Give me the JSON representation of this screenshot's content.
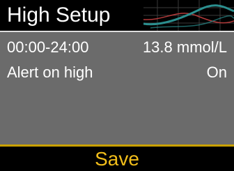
{
  "header": {
    "title": "High Setup"
  },
  "settings": {
    "rows": [
      {
        "label": "00:00-24:00",
        "value": "13.8 mmol/L"
      },
      {
        "label": "Alert on high",
        "value": "On"
      }
    ]
  },
  "footer": {
    "save_label": "Save"
  },
  "colors": {
    "background": "#6b6b6b",
    "header": "#000000",
    "accent": "#f2be1a",
    "graphic_teal": "#2b8f8f",
    "graphic_red": "#b23a3a"
  },
  "icons": {
    "header_decoration": "glucose-trend-graphic-icon"
  }
}
